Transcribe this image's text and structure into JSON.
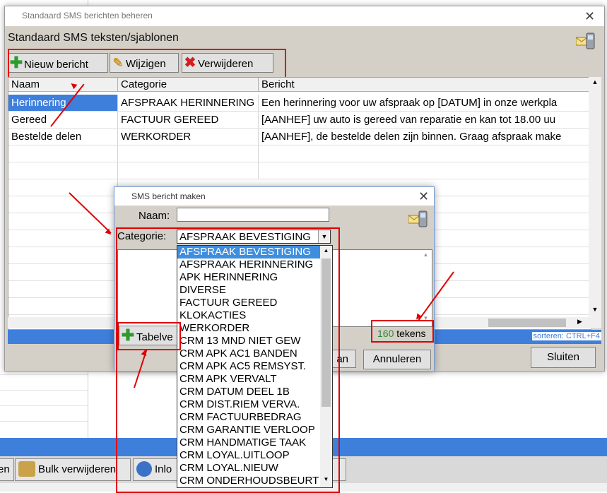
{
  "background_app": {
    "bulk_delete_label": "Bulk verwijderen",
    "inlo_label": "Inlo",
    "partial_left_label": "en",
    "partial_right_label": "st"
  },
  "main_window": {
    "title": "Standaard SMS berichten beheren",
    "heading": "Standaard SMS teksten/sjablonen",
    "toolbar": {
      "new_label": "Nieuw bericht",
      "edit_label": "Wijzigen",
      "delete_label": "Verwijderen"
    },
    "table": {
      "columns": [
        "Naam",
        "Categorie",
        "Bericht"
      ],
      "rows": [
        {
          "naam": "Herinnering",
          "categorie": "AFSPRAAK HERINNERING",
          "bericht": "Een herinnering voor uw afspraak op [DATUM] in onze werkpla"
        },
        {
          "naam": "Gereed",
          "categorie": "FACTUUR GEREED",
          "bericht": "[AANHEF] uw auto is gereed van reparatie en kan tot 18.00 uu"
        },
        {
          "naam": "Bestelde delen",
          "categorie": "WERKORDER",
          "bericht": "[AANHEF], de bestelde delen zijn binnen. Graag afspraak make"
        }
      ]
    },
    "sort_hint": "sorteren: CTRL+F4",
    "close_label": "Sluiten"
  },
  "dialog": {
    "title": "SMS bericht maken",
    "name_label": "Naam:",
    "name_value": "",
    "category_label": "Categorie:",
    "category_value": "AFSPRAAK BEVESTIGING",
    "char_count": "160",
    "char_unit": "tekens",
    "tabel_label": "Tabelve",
    "ok_partial_label": "an",
    "cancel_label": "Annuleren",
    "category_options": [
      "AFSPRAAK BEVESTIGING",
      "AFSPRAAK HERINNERING",
      "APK HERINNERING",
      "DIVERSE",
      "FACTUUR GEREED",
      "KLOKACTIES",
      "WERKORDER",
      "CRM 13 MND NIET GEW",
      "CRM APK AC1 BANDEN",
      "CRM APK AC5 REMSYST.",
      "CRM APK VERVALT",
      "CRM DATUM DEEL 1B",
      "CRM DIST.RIEM VERVA.",
      "CRM FACTUURBEDRAG",
      "CRM GARANTIE VERLOOP",
      "CRM HANDMATIGE TAAK",
      "CRM LOYAL.UITLOOP",
      "CRM LOYAL.NIEUW",
      "CRM ONDERHOUDSBEURT"
    ]
  },
  "colors": {
    "selection": "#3f7fdc",
    "annotation": "#e00000",
    "char_count": "#2e8b2e"
  }
}
